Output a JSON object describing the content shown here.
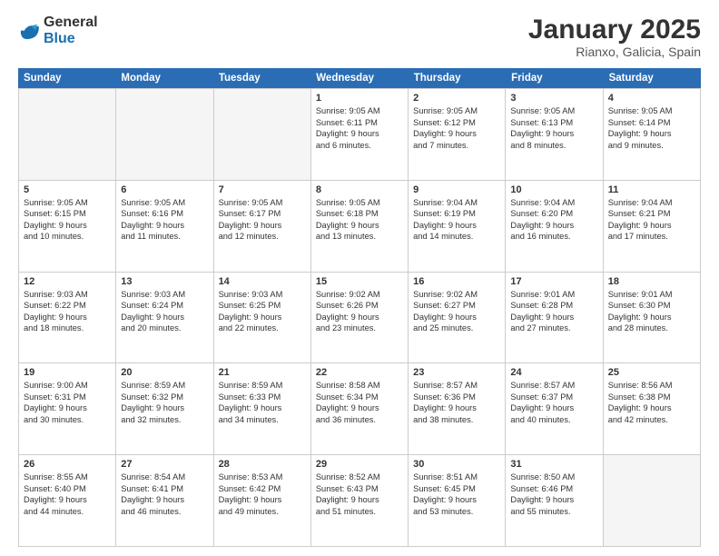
{
  "logo": {
    "general": "General",
    "blue": "Blue"
  },
  "header": {
    "month_year": "January 2025",
    "location": "Rianxo, Galicia, Spain"
  },
  "days_of_week": [
    "Sunday",
    "Monday",
    "Tuesday",
    "Wednesday",
    "Thursday",
    "Friday",
    "Saturday"
  ],
  "weeks": [
    [
      {
        "day": "",
        "empty": true
      },
      {
        "day": "",
        "empty": true
      },
      {
        "day": "",
        "empty": true
      },
      {
        "day": "1",
        "lines": [
          "Sunrise: 9:05 AM",
          "Sunset: 6:11 PM",
          "Daylight: 9 hours",
          "and 6 minutes."
        ]
      },
      {
        "day": "2",
        "lines": [
          "Sunrise: 9:05 AM",
          "Sunset: 6:12 PM",
          "Daylight: 9 hours",
          "and 7 minutes."
        ]
      },
      {
        "day": "3",
        "lines": [
          "Sunrise: 9:05 AM",
          "Sunset: 6:13 PM",
          "Daylight: 9 hours",
          "and 8 minutes."
        ]
      },
      {
        "day": "4",
        "lines": [
          "Sunrise: 9:05 AM",
          "Sunset: 6:14 PM",
          "Daylight: 9 hours",
          "and 9 minutes."
        ]
      }
    ],
    [
      {
        "day": "5",
        "lines": [
          "Sunrise: 9:05 AM",
          "Sunset: 6:15 PM",
          "Daylight: 9 hours",
          "and 10 minutes."
        ]
      },
      {
        "day": "6",
        "lines": [
          "Sunrise: 9:05 AM",
          "Sunset: 6:16 PM",
          "Daylight: 9 hours",
          "and 11 minutes."
        ]
      },
      {
        "day": "7",
        "lines": [
          "Sunrise: 9:05 AM",
          "Sunset: 6:17 PM",
          "Daylight: 9 hours",
          "and 12 minutes."
        ]
      },
      {
        "day": "8",
        "lines": [
          "Sunrise: 9:05 AM",
          "Sunset: 6:18 PM",
          "Daylight: 9 hours",
          "and 13 minutes."
        ]
      },
      {
        "day": "9",
        "lines": [
          "Sunrise: 9:04 AM",
          "Sunset: 6:19 PM",
          "Daylight: 9 hours",
          "and 14 minutes."
        ]
      },
      {
        "day": "10",
        "lines": [
          "Sunrise: 9:04 AM",
          "Sunset: 6:20 PM",
          "Daylight: 9 hours",
          "and 16 minutes."
        ]
      },
      {
        "day": "11",
        "lines": [
          "Sunrise: 9:04 AM",
          "Sunset: 6:21 PM",
          "Daylight: 9 hours",
          "and 17 minutes."
        ]
      }
    ],
    [
      {
        "day": "12",
        "lines": [
          "Sunrise: 9:03 AM",
          "Sunset: 6:22 PM",
          "Daylight: 9 hours",
          "and 18 minutes."
        ]
      },
      {
        "day": "13",
        "lines": [
          "Sunrise: 9:03 AM",
          "Sunset: 6:24 PM",
          "Daylight: 9 hours",
          "and 20 minutes."
        ]
      },
      {
        "day": "14",
        "lines": [
          "Sunrise: 9:03 AM",
          "Sunset: 6:25 PM",
          "Daylight: 9 hours",
          "and 22 minutes."
        ]
      },
      {
        "day": "15",
        "lines": [
          "Sunrise: 9:02 AM",
          "Sunset: 6:26 PM",
          "Daylight: 9 hours",
          "and 23 minutes."
        ]
      },
      {
        "day": "16",
        "lines": [
          "Sunrise: 9:02 AM",
          "Sunset: 6:27 PM",
          "Daylight: 9 hours",
          "and 25 minutes."
        ]
      },
      {
        "day": "17",
        "lines": [
          "Sunrise: 9:01 AM",
          "Sunset: 6:28 PM",
          "Daylight: 9 hours",
          "and 27 minutes."
        ]
      },
      {
        "day": "18",
        "lines": [
          "Sunrise: 9:01 AM",
          "Sunset: 6:30 PM",
          "Daylight: 9 hours",
          "and 28 minutes."
        ]
      }
    ],
    [
      {
        "day": "19",
        "lines": [
          "Sunrise: 9:00 AM",
          "Sunset: 6:31 PM",
          "Daylight: 9 hours",
          "and 30 minutes."
        ]
      },
      {
        "day": "20",
        "lines": [
          "Sunrise: 8:59 AM",
          "Sunset: 6:32 PM",
          "Daylight: 9 hours",
          "and 32 minutes."
        ]
      },
      {
        "day": "21",
        "lines": [
          "Sunrise: 8:59 AM",
          "Sunset: 6:33 PM",
          "Daylight: 9 hours",
          "and 34 minutes."
        ]
      },
      {
        "day": "22",
        "lines": [
          "Sunrise: 8:58 AM",
          "Sunset: 6:34 PM",
          "Daylight: 9 hours",
          "and 36 minutes."
        ]
      },
      {
        "day": "23",
        "lines": [
          "Sunrise: 8:57 AM",
          "Sunset: 6:36 PM",
          "Daylight: 9 hours",
          "and 38 minutes."
        ]
      },
      {
        "day": "24",
        "lines": [
          "Sunrise: 8:57 AM",
          "Sunset: 6:37 PM",
          "Daylight: 9 hours",
          "and 40 minutes."
        ]
      },
      {
        "day": "25",
        "lines": [
          "Sunrise: 8:56 AM",
          "Sunset: 6:38 PM",
          "Daylight: 9 hours",
          "and 42 minutes."
        ]
      }
    ],
    [
      {
        "day": "26",
        "lines": [
          "Sunrise: 8:55 AM",
          "Sunset: 6:40 PM",
          "Daylight: 9 hours",
          "and 44 minutes."
        ]
      },
      {
        "day": "27",
        "lines": [
          "Sunrise: 8:54 AM",
          "Sunset: 6:41 PM",
          "Daylight: 9 hours",
          "and 46 minutes."
        ]
      },
      {
        "day": "28",
        "lines": [
          "Sunrise: 8:53 AM",
          "Sunset: 6:42 PM",
          "Daylight: 9 hours",
          "and 49 minutes."
        ]
      },
      {
        "day": "29",
        "lines": [
          "Sunrise: 8:52 AM",
          "Sunset: 6:43 PM",
          "Daylight: 9 hours",
          "and 51 minutes."
        ]
      },
      {
        "day": "30",
        "lines": [
          "Sunrise: 8:51 AM",
          "Sunset: 6:45 PM",
          "Daylight: 9 hours",
          "and 53 minutes."
        ]
      },
      {
        "day": "31",
        "lines": [
          "Sunrise: 8:50 AM",
          "Sunset: 6:46 PM",
          "Daylight: 9 hours",
          "and 55 minutes."
        ]
      },
      {
        "day": "",
        "empty": true
      }
    ]
  ]
}
